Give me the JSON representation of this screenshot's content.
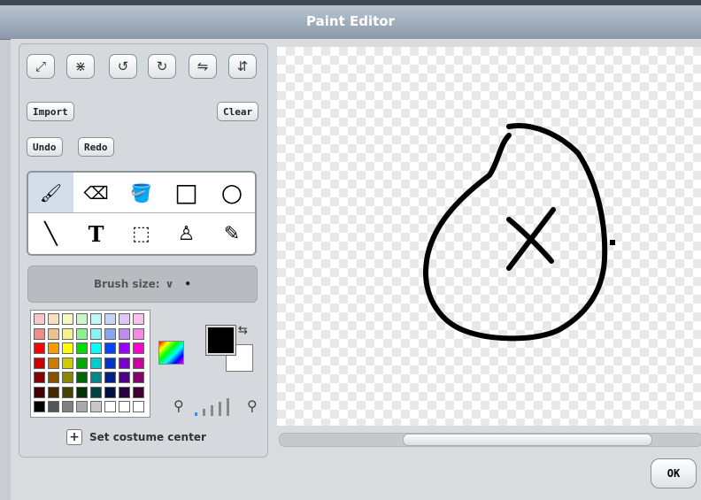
{
  "window": {
    "title": "Paint Editor"
  },
  "transform_buttons": [
    {
      "name": "grow-icon",
      "glyph": "⤢"
    },
    {
      "name": "shrink-icon",
      "glyph": "⋇"
    },
    {
      "name": "rotate-left-icon",
      "glyph": "↺"
    },
    {
      "name": "rotate-right-icon",
      "glyph": "↻"
    },
    {
      "name": "flip-horizontal-icon",
      "glyph": "⇋"
    },
    {
      "name": "flip-vertical-icon",
      "glyph": "⇵"
    }
  ],
  "actions": {
    "import": "Import",
    "clear": "Clear",
    "undo": "Undo",
    "redo": "Redo"
  },
  "tools": [
    {
      "name": "paintbrush-tool",
      "glyph": "🖌",
      "selected": true
    },
    {
      "name": "eraser-tool",
      "glyph": "⌫",
      "selected": false
    },
    {
      "name": "fill-tool",
      "glyph": "🪣",
      "selected": false
    },
    {
      "name": "rectangle-tool",
      "glyph": "□",
      "selected": false
    },
    {
      "name": "ellipse-tool",
      "glyph": "○",
      "selected": false
    },
    {
      "name": "line-tool",
      "glyph": "╲",
      "selected": false
    },
    {
      "name": "text-tool",
      "glyph": "T",
      "selected": false
    },
    {
      "name": "select-tool",
      "glyph": "⬚",
      "selected": false
    },
    {
      "name": "stamp-tool",
      "glyph": "♙",
      "selected": false
    },
    {
      "name": "eyedropper-tool",
      "glyph": "✎",
      "selected": false
    }
  ],
  "brush": {
    "label": "Brush size:",
    "chevron": "∨",
    "dot": "•"
  },
  "palette": [
    [
      "#f7c7c7",
      "#f7dfc0",
      "#f7f7c0",
      "#c9f7c9",
      "#c0f7f7",
      "#c7d3f7",
      "#dfc7f7",
      "#f7c0f0"
    ],
    [
      "#f28a8a",
      "#f2c08a",
      "#f2f28a",
      "#8af28a",
      "#8af2f2",
      "#8aa4f2",
      "#c08af2",
      "#f28ae6"
    ],
    [
      "#ff0000",
      "#ff9900",
      "#ffff00",
      "#00dd00",
      "#00ffff",
      "#0044ff",
      "#9900ff",
      "#ff00cc"
    ],
    [
      "#cc0000",
      "#cc7a00",
      "#cccc00",
      "#00aa00",
      "#00cccc",
      "#0033cc",
      "#7a00cc",
      "#cc00a3"
    ],
    [
      "#880000",
      "#885100",
      "#888800",
      "#006600",
      "#008888",
      "#002288",
      "#510088",
      "#88006b"
    ],
    [
      "#440000",
      "#442900",
      "#444400",
      "#003300",
      "#004444",
      "#001144",
      "#290044",
      "#440036"
    ],
    [
      "#000000",
      "#555555",
      "#808080",
      "#aaaaaa",
      "#c8c8c8",
      "#ffffff",
      "#ffffff",
      "#ffffff"
    ]
  ],
  "colors": {
    "foreground": "#000000",
    "background": "#ffffff",
    "accent": "#d3ddea"
  },
  "set_center": {
    "label": "Set costume center",
    "icon": "+"
  },
  "ok": "OK"
}
